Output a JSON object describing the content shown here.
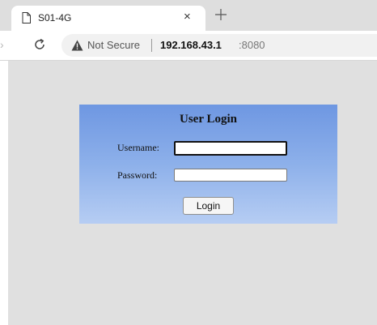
{
  "browser": {
    "tab": {
      "title": "S01-4G",
      "close_glyph": "×",
      "icon": "document-icon"
    },
    "new_tab_icon": "plus-icon",
    "toolbar": {
      "forward_glyph": "›",
      "reload_icon": "reload-icon"
    },
    "address_bar": {
      "security_icon": "warning-triangle-icon",
      "security_text": "Not Secure",
      "host": "192.168.43.1",
      "port": ":8080"
    }
  },
  "page": {
    "background_color": "#e0e0e0",
    "login": {
      "title": "User Login",
      "username_label": "Username:",
      "username_value": "",
      "password_label": "Password:",
      "password_value": "",
      "button_label": "Login",
      "gradient_top": "#6e97e2",
      "gradient_bottom": "#b6cdf3"
    }
  }
}
